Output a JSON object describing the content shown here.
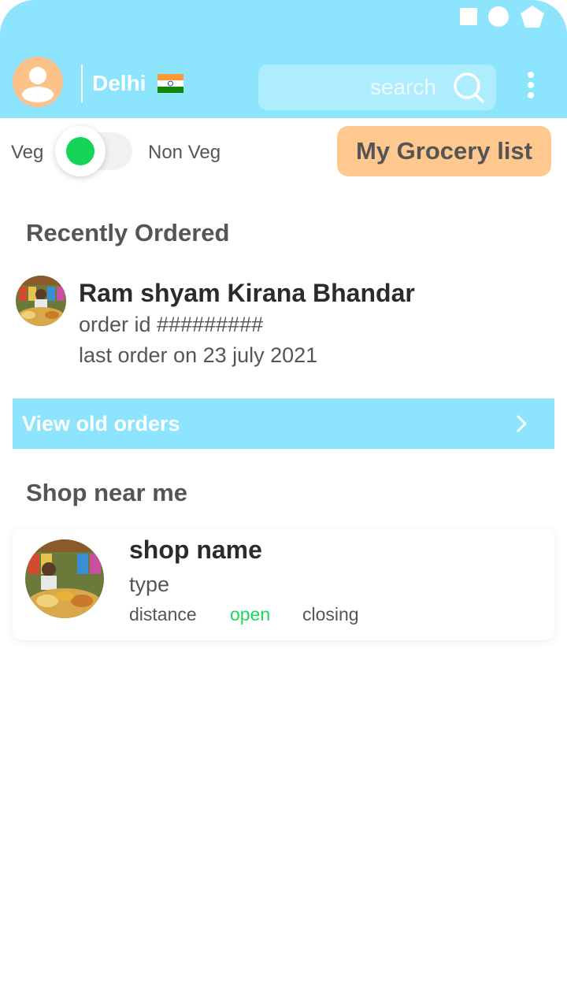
{
  "header": {
    "city": "Delhi",
    "search_placeholder": "search",
    "status_icons": [
      "square-icon",
      "circle-icon",
      "pentagon-icon"
    ],
    "background": "#8ce5fd"
  },
  "filters": {
    "veg_label": "Veg",
    "non_veg_label": "Non Veg",
    "veg_selected": true,
    "grocery_button_label": "My Grocery list"
  },
  "recent": {
    "title": "Recently Ordered",
    "shop_name": "Ram shyam Kirana Bhandar",
    "order_id": "order id #########",
    "last_order": "last order on 23 july 2021"
  },
  "old_orders": {
    "label": "View old orders"
  },
  "nearby": {
    "title": "Shop near me",
    "shop": {
      "name": "shop name",
      "type": "type",
      "distance": "distance",
      "status": "open",
      "closing": "closing"
    }
  },
  "colors": {
    "accent": "#8ce5fd",
    "grocery_button": "#fec88e",
    "avatar_bg": "#fbc28a",
    "open_status": "#1fd75c",
    "veg_dot": "#14d55a"
  }
}
